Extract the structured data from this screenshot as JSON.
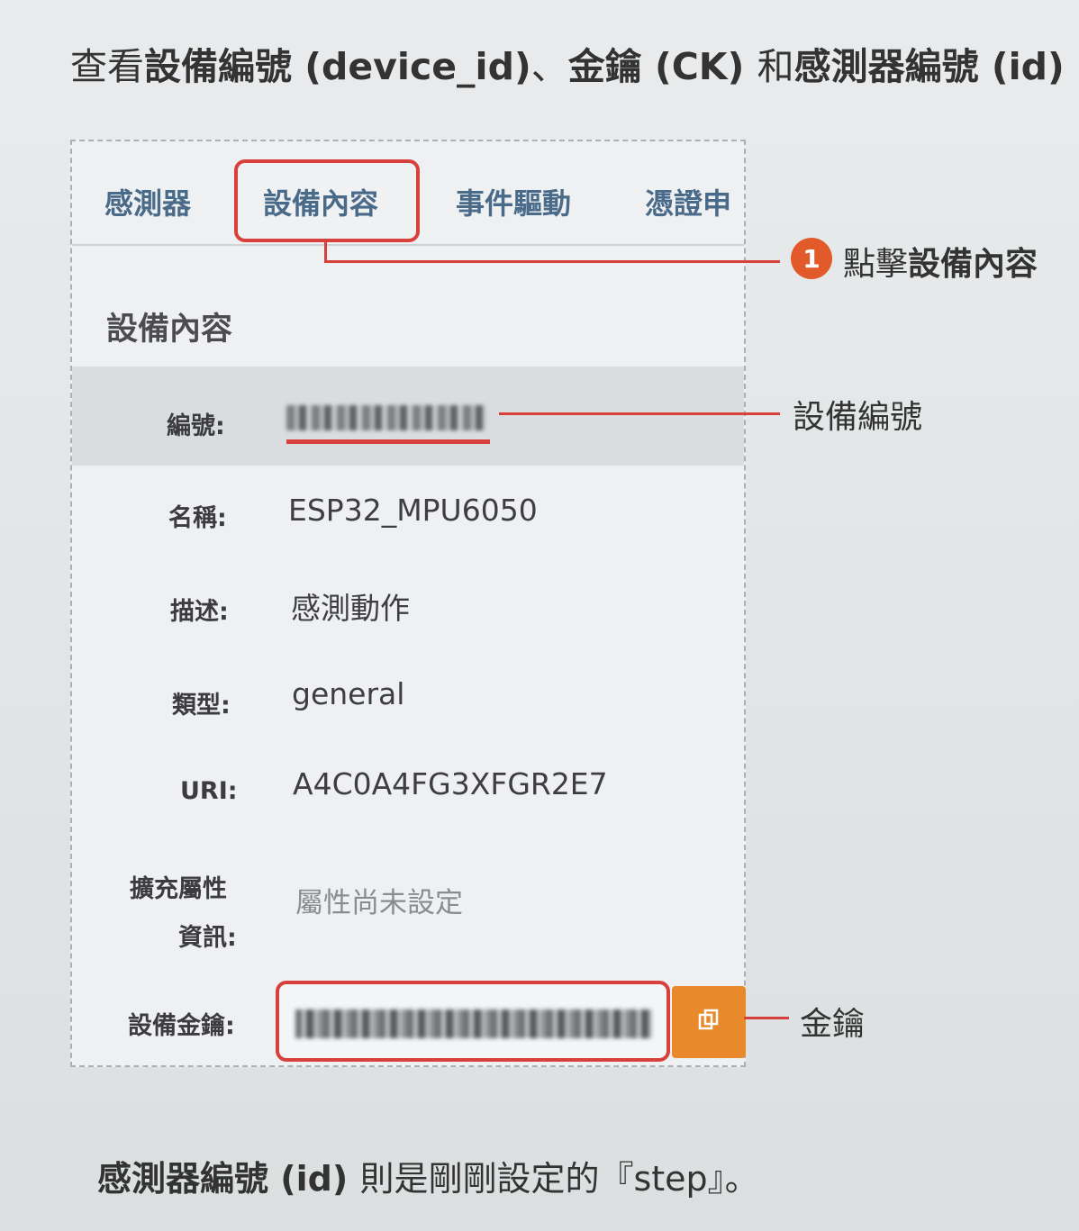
{
  "heading": {
    "prefix": "查看",
    "term1": "設備編號",
    "term1_en": " (device_id)",
    "sep1": "、",
    "term2": "金鑰",
    "term2_en": " (CK) ",
    "join": "和",
    "term3": "感測器編號",
    "term3_en": " (id)"
  },
  "tabs": [
    "感測器",
    "設備內容",
    "事件驅動",
    "憑證申"
  ],
  "section_title": "設備內容",
  "fields": {
    "id_label": "編號:",
    "name_label": "名稱:",
    "name_value": "ESP32_MPU6050",
    "desc_label": "描述:",
    "desc_value": "感測動作",
    "type_label": "類型:",
    "type_value": "general",
    "uri_label": "URI:",
    "uri_value": "A4C0A4FG3XFGR2E7",
    "ext_label_1": "擴充屬性",
    "ext_label_2": "資訊:",
    "ext_value": "屬性尚未設定",
    "key_label": "設備金鑰:"
  },
  "callouts": {
    "step_number": "1",
    "step_prefix": "點擊",
    "step_target": "設備內容",
    "device_id": "設備編號",
    "key": "金鑰"
  },
  "footer": {
    "term": "感測器編號",
    "term_en": " (id) ",
    "rest": "則是剛剛設定的『step』。"
  },
  "colors": {
    "highlight": "#d8413b",
    "copy_button": "#e88a2b",
    "tab_text": "#4a6a8a"
  },
  "icons": {
    "copy": "copy-icon"
  }
}
